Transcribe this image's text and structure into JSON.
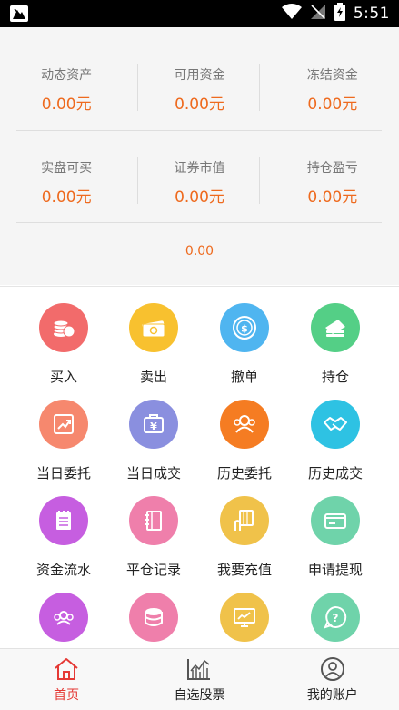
{
  "status_bar": {
    "time": "5:51"
  },
  "summary": {
    "row1": [
      {
        "label": "动态资产",
        "value": "0.00元"
      },
      {
        "label": "可用资金",
        "value": "0.00元"
      },
      {
        "label": "冻结资金",
        "value": "0.00元"
      }
    ],
    "row2": [
      {
        "label": "实盘可买",
        "value": "0.00元"
      },
      {
        "label": "证券市值",
        "value": "0.00元"
      },
      {
        "label": "持仓盈亏",
        "value": "0.00元"
      }
    ],
    "total": "0.00"
  },
  "menu": [
    {
      "label": "买入",
      "icon": "coins-icon",
      "color": "#f26b6b"
    },
    {
      "label": "卖出",
      "icon": "cash-bundle-icon",
      "color": "#f8c12f"
    },
    {
      "label": "撤单",
      "icon": "dollar-coin-icon",
      "color": "#4fb5f0"
    },
    {
      "label": "持仓",
      "icon": "money-stack-icon",
      "color": "#54cf86"
    },
    {
      "label": "当日委托",
      "icon": "trend-chart-icon",
      "color": "#f6886e"
    },
    {
      "label": "当日成交",
      "icon": "yuan-bag-icon",
      "color": "#8a8fdf"
    },
    {
      "label": "历史委托",
      "icon": "group-icon",
      "color": "#f57c22"
    },
    {
      "label": "历史成交",
      "icon": "handshake-icon",
      "color": "#2ec2e3"
    },
    {
      "label": "资金流水",
      "icon": "notepad-icon",
      "color": "#c65ee0"
    },
    {
      "label": "平仓记录",
      "icon": "notebook-icon",
      "color": "#ef7fab"
    },
    {
      "label": "我要充值",
      "icon": "hand-card-icon",
      "color": "#f0c24a"
    },
    {
      "label": "申请提现",
      "icon": "card-icon",
      "color": "#6fd3aa"
    },
    {
      "label": "",
      "icon": "people-icon",
      "color": "#c65ee0"
    },
    {
      "label": "",
      "icon": "database-icon",
      "color": "#ef7fab"
    },
    {
      "label": "",
      "icon": "monitor-icon",
      "color": "#f0c24a"
    },
    {
      "label": "",
      "icon": "help-icon",
      "color": "#6fd3aa"
    }
  ],
  "tabs": [
    {
      "label": "首页",
      "icon": "home-icon",
      "active": true
    },
    {
      "label": "自选股票",
      "icon": "stock-chart-icon",
      "active": false
    },
    {
      "label": "我的账户",
      "icon": "user-icon",
      "active": false
    }
  ],
  "colors": {
    "accent": "#ee6a1e",
    "tab_active": "#e53935"
  }
}
